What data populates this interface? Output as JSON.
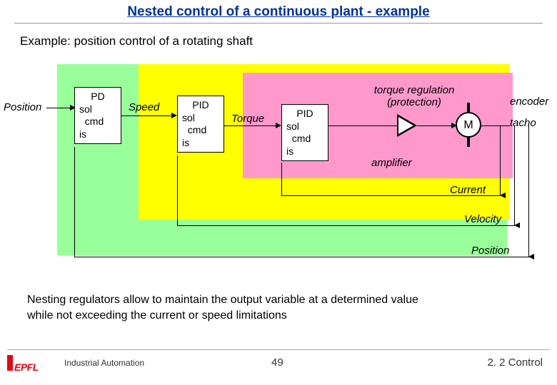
{
  "title": "Nested control of a continuous plant - example",
  "subtitle": "Example: position control of a rotating shaft",
  "labels": {
    "position_in": "Position",
    "speed": "Speed",
    "torque": "Torque",
    "torque_reg": "torque regulation",
    "protection": "(protection)",
    "encoder": "encoder",
    "tacho": "tacho",
    "amplifier": "amplifier",
    "current_fb": "Current",
    "velocity_fb": "Velocity",
    "position_fb": "Position",
    "motor": "M"
  },
  "controllers": {
    "c1": {
      "type": "PD",
      "l1": "sol",
      "l2": "  cmd",
      "l3": "is"
    },
    "c2": {
      "type": "PID",
      "l1": "sol",
      "l2": "  cmd",
      "l3": "is"
    },
    "c3": {
      "type": "PID",
      "l1": "sol",
      "l2": "  cmd",
      "l3": "is"
    }
  },
  "caption_line1": "Nesting regulators allow to maintain the output variable at a determined value",
  "caption_line2": "while not exceeding the current or speed limitations",
  "footer": {
    "logo_text": "EPFL",
    "mid": "Industrial Automation",
    "page": "49",
    "section": "2. 2 Control"
  }
}
